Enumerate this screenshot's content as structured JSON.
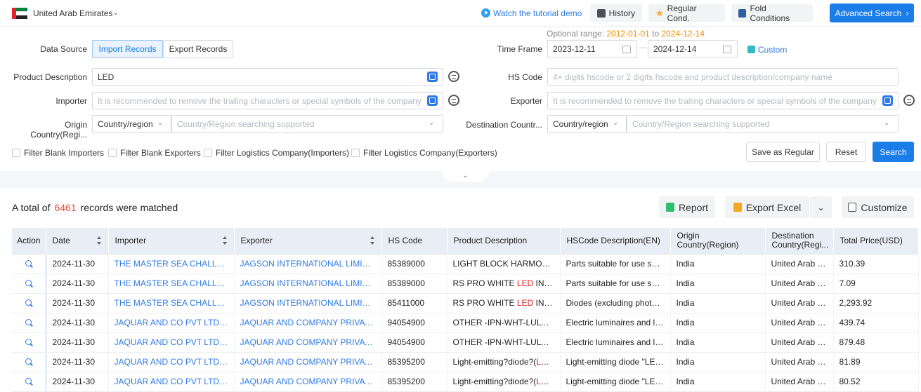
{
  "topbar": {
    "country": "United Arab Emirates",
    "tutorial": "Watch the tutorial demo",
    "history": "History",
    "regular_cond": "Regular Cond.",
    "fold_conditions": "Fold Conditions",
    "advanced_search": "Advanced Search"
  },
  "optional_range": {
    "label": "Optional range:",
    "from": "2012-01-01",
    "to_word": "to",
    "to": "2024-12-14"
  },
  "form": {
    "data_source_label": "Data Source",
    "import_records": "Import Records",
    "export_records": "Export Records",
    "time_frame_label": "Time Frame",
    "date_from": "2023-12-11",
    "date_to": "2024-12-14",
    "date_sep": "—",
    "custom": "Custom",
    "product_description_label": "Product Description",
    "product_description_value": "LED",
    "hs_code_label": "HS Code",
    "hs_code_placeholder": "4+ digits hscode or 2 digits hscode and product description/company name",
    "importer_label": "Importer",
    "importer_placeholder": "It is recommended to remove the trailing characters or special symbols of the company",
    "exporter_label": "Exporter",
    "exporter_placeholder": "It is recommended to remove the trailing characters or special symbols of the company",
    "origin_label": "Origin Country(Regi...",
    "origin_select": "Country/region",
    "origin_placeholder": "Country/Region searching supported",
    "destination_label": "Destination Countr...",
    "destination_select": "Country/region",
    "destination_placeholder": "Country/Region searching supported"
  },
  "filters": {
    "blank_importers": "Filter Blank Importers",
    "blank_exporters": "Filter Blank Exporters",
    "logistics_importers": "Filter Logistics Company(Importers)",
    "logistics_exporters": "Filter Logistics Company(Exporters)"
  },
  "actions": {
    "save_regular": "Save as Regular",
    "reset": "Reset",
    "search": "Search"
  },
  "results": {
    "prefix": "A total of",
    "count": "6461",
    "suffix": "records were matched",
    "report": "Report",
    "export_excel": "Export Excel",
    "customize": "Customize"
  },
  "table": {
    "headers": {
      "action": "Action",
      "date": "Date",
      "importer": "Importer",
      "exporter": "Exporter",
      "hs_code": "HS Code",
      "product_description": "Product Description",
      "hscode_description": "HSCode Description(EN)",
      "origin": "Origin Country(Region)",
      "destination": "Destination Country(Regi...",
      "total_price": "Total Price(USD)"
    },
    "rows": [
      {
        "date": "2024-11-30",
        "importer": "THE MASTER SEA CHALLENG...",
        "exporter": "JAGSON INTERNATIONAL LIMITED",
        "hs": "85389000",
        "desc_pre": "LIGHT BLOCK HARMONEY ...",
        "desc_led": "",
        "desc_post": "",
        "hsdesc": "Parts suitable for use solel...",
        "origin": "India",
        "dest": "United Arab Emi",
        "price": "310.39"
      },
      {
        "date": "2024-11-30",
        "importer": "THE MASTER SEA CHALLENG...",
        "exporter": "JAGSON INTERNATIONAL LIMITED",
        "hs": "85389000",
        "desc_pre": "RS PRO WHITE ",
        "desc_led": "LED",
        "desc_post": " INDICA...",
        "hsdesc": "Parts suitable for use solel...",
        "origin": "India",
        "dest": "United Arab Emi",
        "price": "7.09"
      },
      {
        "date": "2024-11-30",
        "importer": "THE MASTER SEA CHALLENG...",
        "exporter": "JAGSON INTERNATIONAL LIMITED",
        "hs": "85411000",
        "desc_pre": "RS PRO WHITE ",
        "desc_led": "LED",
        "desc_post": " INDICA...",
        "hsdesc": "Diodes (excluding photose...",
        "origin": "India",
        "dest": "United Arab Emi",
        "price": "2,293.92"
      },
      {
        "date": "2024-11-30",
        "importer": "JAQUAR AND CO PVT LTD JCP...",
        "exporter": "JAQUAR AND COMPANY PRIVATE LI...",
        "hs": "94054900",
        "desc_pre": "OTHER -IPN-WHT-LULTSL...",
        "desc_led": "",
        "desc_post": "",
        "hsdesc": "Electric luminaires and lig...",
        "origin": "India",
        "dest": "United Arab Emi",
        "price": "439.74"
      },
      {
        "date": "2024-11-30",
        "importer": "JAQUAR AND CO PVT LTD JCP...",
        "exporter": "JAQUAR AND COMPANY PRIVATE LI...",
        "hs": "94054900",
        "desc_pre": "OTHER -IPN-WHT-LULTSL...",
        "desc_led": "",
        "desc_post": "",
        "hsdesc": "Electric luminaires and lig...",
        "origin": "India",
        "dest": "United Arab Emi",
        "price": "879.48"
      },
      {
        "date": "2024-11-30",
        "importer": "JAQUAR AND CO PVT LTD JCP...",
        "exporter": "JAQUAR AND COMPANY PRIVATE LI...",
        "hs": "85395200",
        "desc_pre": "Light-emitting?diode?(",
        "desc_led": "LED",
        "desc_post": ")...",
        "hsdesc": "Light-emitting diode \"LED\"...",
        "origin": "India",
        "dest": "United Arab Emi",
        "price": "81.89"
      },
      {
        "date": "2024-11-30",
        "importer": "JAQUAR AND CO PVT LTD JCP...",
        "exporter": "JAQUAR AND COMPANY PRIVATE LI...",
        "hs": "85395200",
        "desc_pre": "Light-emitting?diode?(",
        "desc_led": "LED",
        "desc_post": ")...",
        "hsdesc": "Light-emitting diode \"LED\"...",
        "origin": "India",
        "dest": "United Arab Emi",
        "price": "80.52"
      }
    ]
  },
  "colors": {
    "primary": "#1b7de8",
    "link": "#2f7ae5",
    "highlight": "#e02020",
    "count": "#e64a3b",
    "date_range": "#f08c00"
  },
  "icons": [
    "uae-flag-icon",
    "chevron-down-icon",
    "play-icon",
    "history-icon",
    "star-icon",
    "fold-icon",
    "chevron-right-icon",
    "calendar-icon",
    "custom-icon",
    "image-search-icon",
    "chat-icon",
    "report-icon",
    "excel-icon",
    "customize-icon",
    "magnifier-icon",
    "sort-icon"
  ]
}
